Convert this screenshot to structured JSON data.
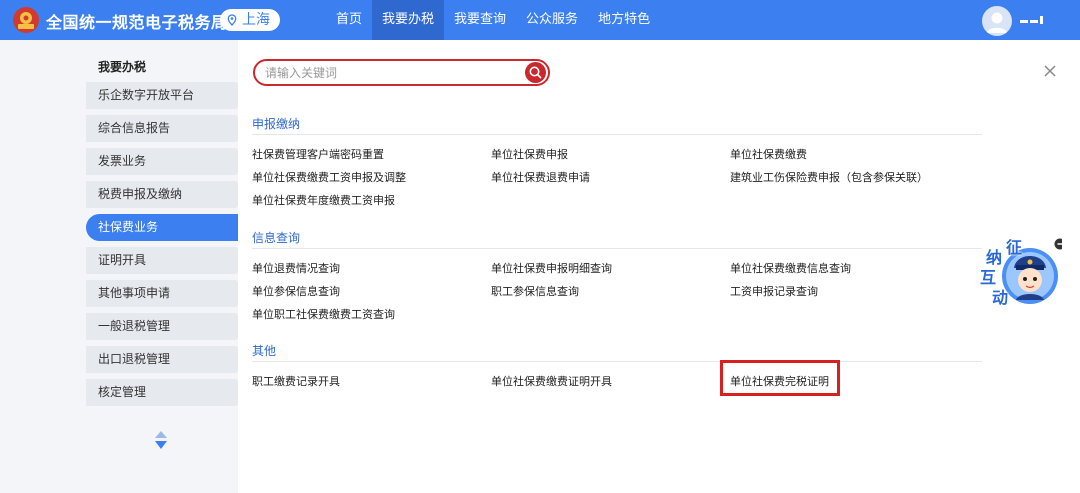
{
  "header": {
    "site_title": "全国统一规范电子税务局",
    "city": "上海",
    "nav": [
      "首页",
      "我要办税",
      "我要查询",
      "公众服务",
      "地方特色"
    ],
    "active_nav": 1
  },
  "sidebar": {
    "title": "我要办税",
    "items": [
      "乐企数字开放平台",
      "综合信息报告",
      "发票业务",
      "税费申报及缴纳",
      "社保费业务",
      "证明开具",
      "其他事项申请",
      "一般退税管理",
      "出口退税管理",
      "核定管理"
    ],
    "active_index": 4
  },
  "search": {
    "placeholder": "请输入关键词"
  },
  "sections": [
    {
      "title": "申报缴纳",
      "links": [
        "社保费管理客户端密码重置",
        "单位社保费申报",
        "单位社保费缴费",
        "单位社保费缴费工资申报及调整",
        "单位社保费退费申请",
        "建筑业工伤保险费申报（包含参保关联）",
        "单位社保费年度缴费工资申报"
      ]
    },
    {
      "title": "信息查询",
      "links": [
        "单位退费情况查询",
        "单位社保费申报明细查询",
        "单位社保费缴费信息查询",
        "单位参保信息查询",
        "职工参保信息查询",
        "工资申报记录查询",
        "单位职工社保费缴费工资查询"
      ]
    },
    {
      "title": "其他",
      "links": [
        "职工缴费记录开具",
        "单位社保费缴费证明开具",
        "单位社保费完税证明"
      ]
    }
  ],
  "mascot": {
    "label_chars": [
      "征",
      "纳",
      "互",
      "动"
    ]
  },
  "colors": {
    "brand_blue": "#3b7ff0",
    "highlight_red": "#d9201e",
    "search_red": "#c9282d"
  }
}
